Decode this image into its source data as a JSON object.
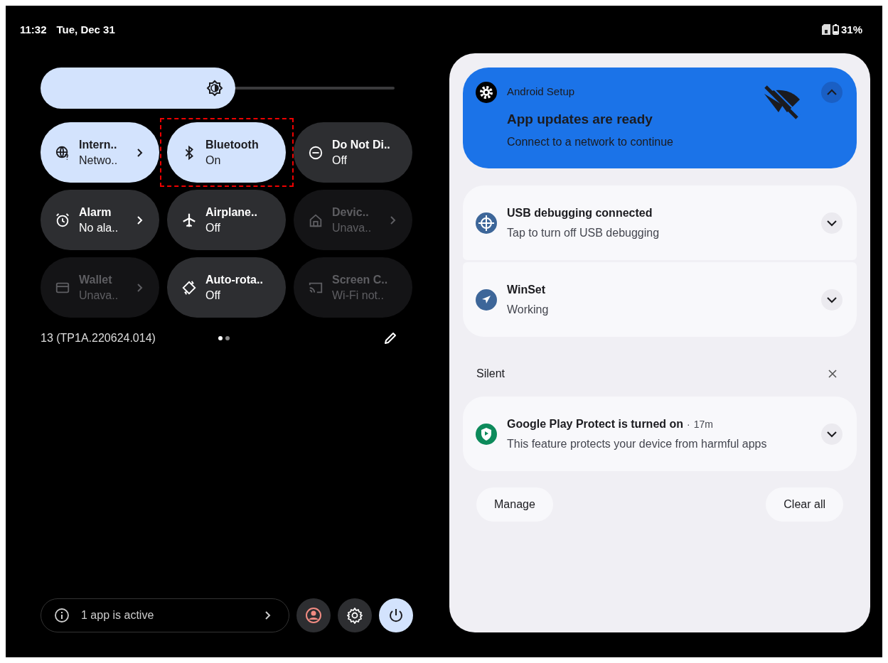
{
  "status_bar": {
    "time": "11:32",
    "date": "Tue, Dec 31",
    "battery": "31%"
  },
  "brightness": {
    "level": 0.55
  },
  "tiles": [
    {
      "kind": "globe",
      "title": "Intern..",
      "subtitle": "Netwo..",
      "on": true,
      "disabled": false,
      "chevron": true,
      "highlighted": false
    },
    {
      "kind": "bluetooth",
      "title": "Bluetooth",
      "subtitle": "On",
      "on": true,
      "disabled": false,
      "chevron": false,
      "highlighted": true
    },
    {
      "kind": "dnd",
      "title": "Do Not Di..",
      "subtitle": "Off",
      "on": false,
      "disabled": false,
      "chevron": false,
      "highlighted": false
    },
    {
      "kind": "alarm",
      "title": "Alarm",
      "subtitle": "No ala..",
      "on": false,
      "disabled": false,
      "chevron": true,
      "highlighted": false
    },
    {
      "kind": "airplane",
      "title": "Airplane..",
      "subtitle": "Off",
      "on": false,
      "disabled": false,
      "chevron": false,
      "highlighted": false
    },
    {
      "kind": "home",
      "title": "Devic..",
      "subtitle": "Unava..",
      "on": false,
      "disabled": true,
      "chevron": true,
      "highlighted": false
    },
    {
      "kind": "card",
      "title": "Wallet",
      "subtitle": "Unava..",
      "on": false,
      "disabled": true,
      "chevron": true,
      "highlighted": false
    },
    {
      "kind": "rotate",
      "title": "Auto-rota..",
      "subtitle": "Off",
      "on": false,
      "disabled": false,
      "chevron": false,
      "highlighted": false
    },
    {
      "kind": "cast",
      "title": "Screen C..",
      "subtitle": "Wi-Fi not..",
      "on": false,
      "disabled": true,
      "chevron": false,
      "highlighted": false
    }
  ],
  "build": "13 (TP1A.220624.014)",
  "pages": [
    {
      "selected": true
    },
    {
      "selected": false
    }
  ],
  "active_apps": "1 app is active",
  "notifications": [
    {
      "kind": "setup",
      "app": "Android Setup",
      "title": "App updates are ready",
      "text": "Connect to a network to continue",
      "expanded": true
    },
    {
      "kind": "debug",
      "title": "USB debugging connected",
      "text": "Tap to turn off USB debugging",
      "expanded": false
    },
    {
      "kind": "navigation",
      "title": "WinSet",
      "text": "Working",
      "expanded": false
    }
  ],
  "silent": {
    "label": "Silent",
    "notifications": [
      {
        "kind": "protect",
        "title": "Google Play Protect is turned on",
        "separator": "·",
        "time": "17m",
        "text": "This feature protects your device from harmful apps",
        "expanded": false
      }
    ]
  },
  "buttons": [
    "Manage",
    "Clear all"
  ]
}
